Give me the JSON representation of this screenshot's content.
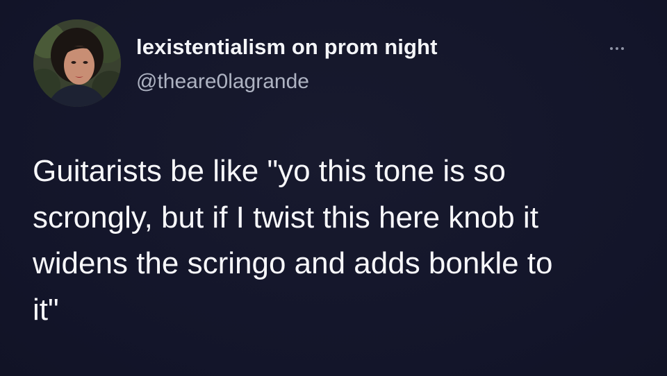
{
  "tweet": {
    "author": {
      "display_name": "lexistentialism on prom night",
      "handle": "@theare0lagrande",
      "avatar_icon": "profile-photo"
    },
    "menu_icon": "more-dots-icon",
    "text_lines": [
      "Guitarists be like \"yo this tone is so",
      "scrongly, but if I twist this here knob it",
      "widens the scringo and adds bonkle to",
      "it\""
    ]
  },
  "colors": {
    "background": "#15172a",
    "primary_text": "#f4f5f8",
    "secondary_text": "#aeb3c2"
  }
}
